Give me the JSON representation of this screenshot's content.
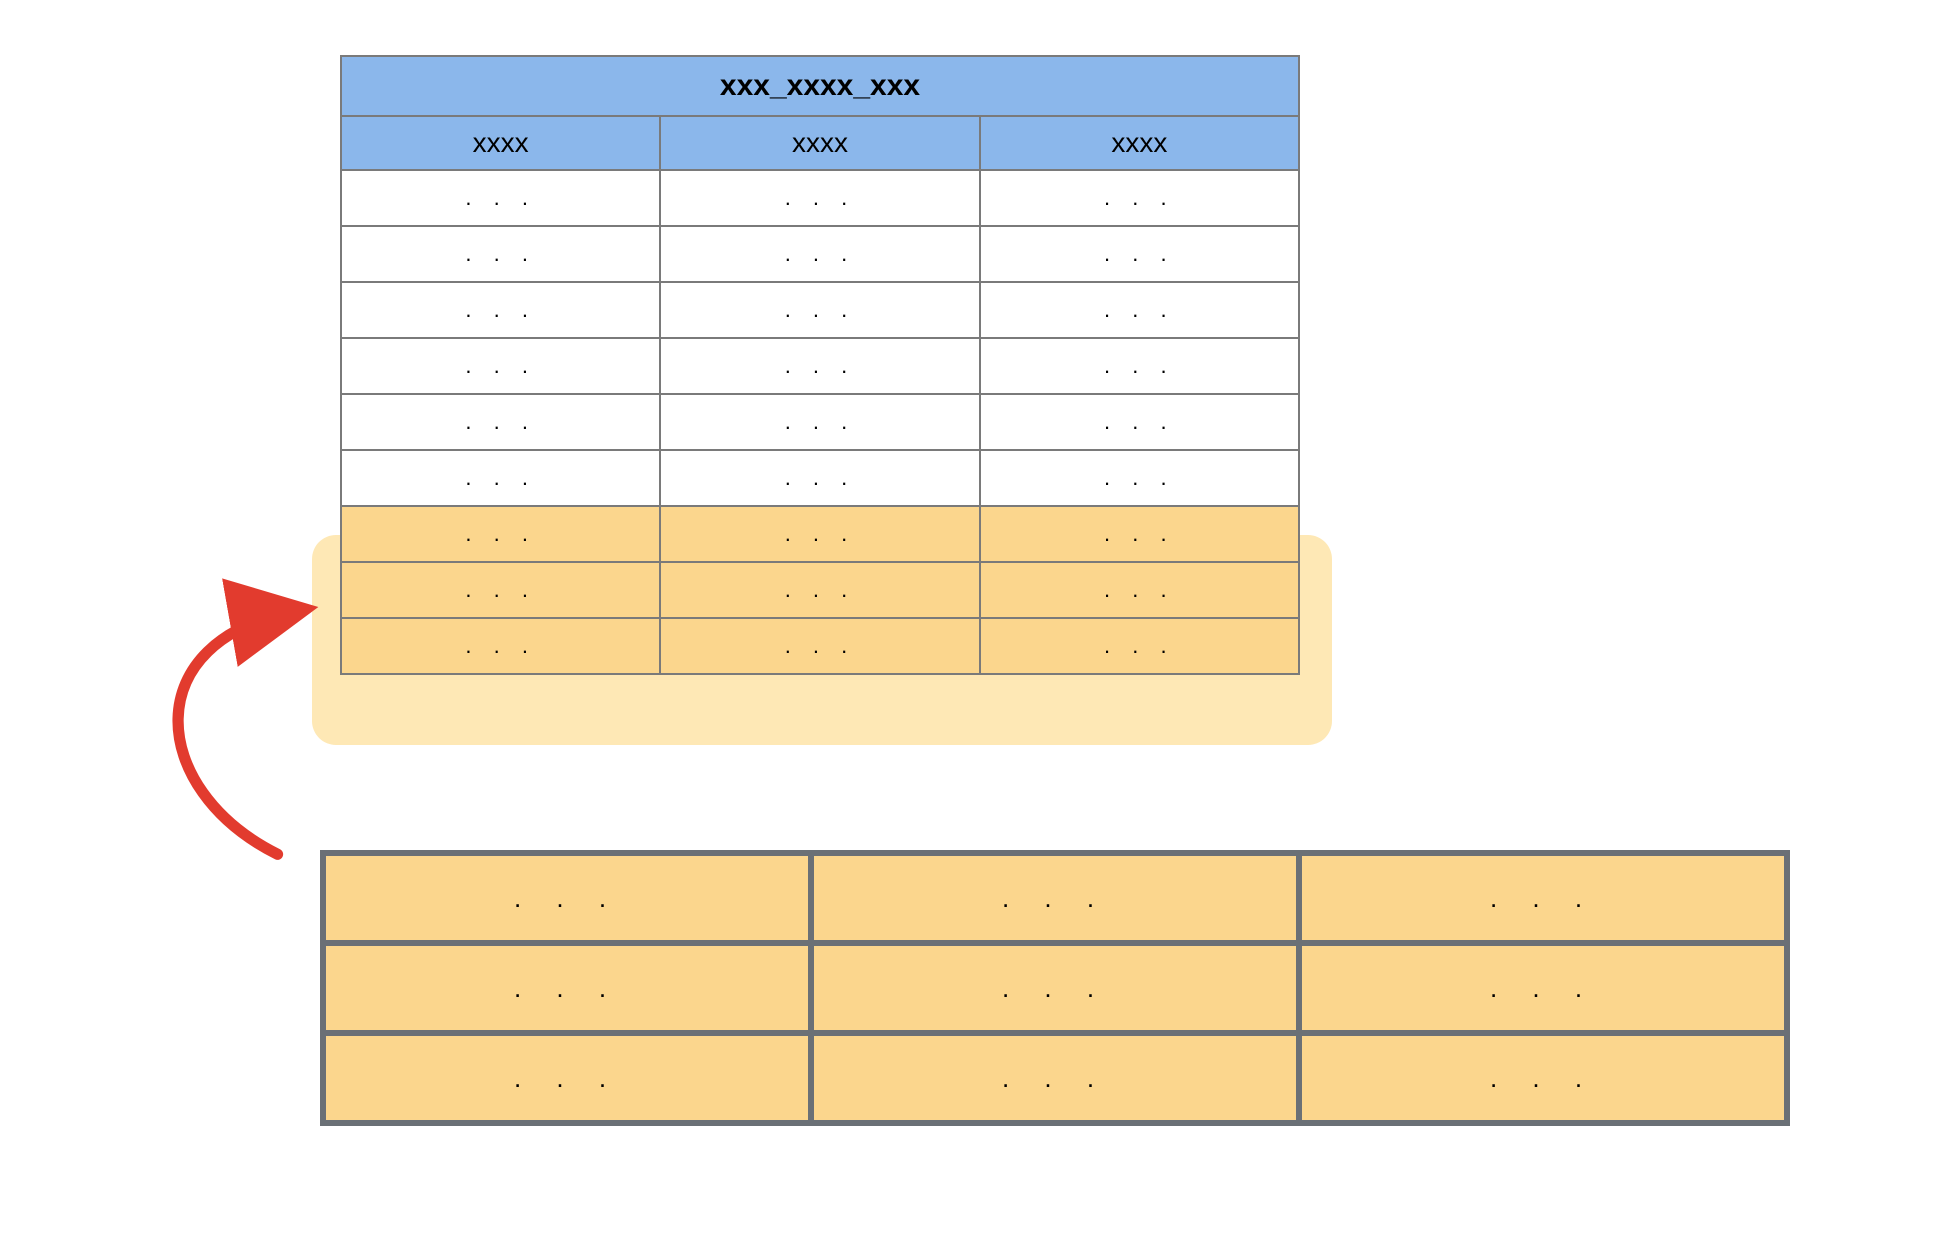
{
  "diagram": {
    "title": "xxx_xxxx_xxx",
    "columns": [
      "xxxx",
      "xxxx",
      "xxxx"
    ],
    "rows": [
      {
        "cells": [
          ". . .",
          ". . .",
          ". . ."
        ],
        "highlighted": false
      },
      {
        "cells": [
          ". . .",
          ". . .",
          ". . ."
        ],
        "highlighted": false
      },
      {
        "cells": [
          ". . .",
          ". . .",
          ". . ."
        ],
        "highlighted": false
      },
      {
        "cells": [
          ". . .",
          ". . .",
          ". . ."
        ],
        "highlighted": false
      },
      {
        "cells": [
          ". . .",
          ". . .",
          ". . ."
        ],
        "highlighted": false
      },
      {
        "cells": [
          ". . .",
          ". . .",
          ". . ."
        ],
        "highlighted": false
      },
      {
        "cells": [
          ". . .",
          ". . .",
          ". . ."
        ],
        "highlighted": true
      },
      {
        "cells": [
          ". . .",
          ". . .",
          ". . ."
        ],
        "highlighted": true
      },
      {
        "cells": [
          ". . .",
          ". . .",
          ". . ."
        ],
        "highlighted": true
      }
    ],
    "bottom_block": {
      "rows": [
        [
          ". . .",
          ". . .",
          ". . ."
        ],
        [
          ". . .",
          ". . .",
          ". . ."
        ],
        [
          ". . .",
          ". . .",
          ". . ."
        ]
      ]
    },
    "colors": {
      "header_bg": "#8bb7eb",
      "highlight_bg": "#fbd68d",
      "highlight_surround": "rgba(253,219,142,0.65)",
      "border": "#7a7a7a",
      "block_border": "#6a7076",
      "arrow": "#e23b2e"
    }
  }
}
